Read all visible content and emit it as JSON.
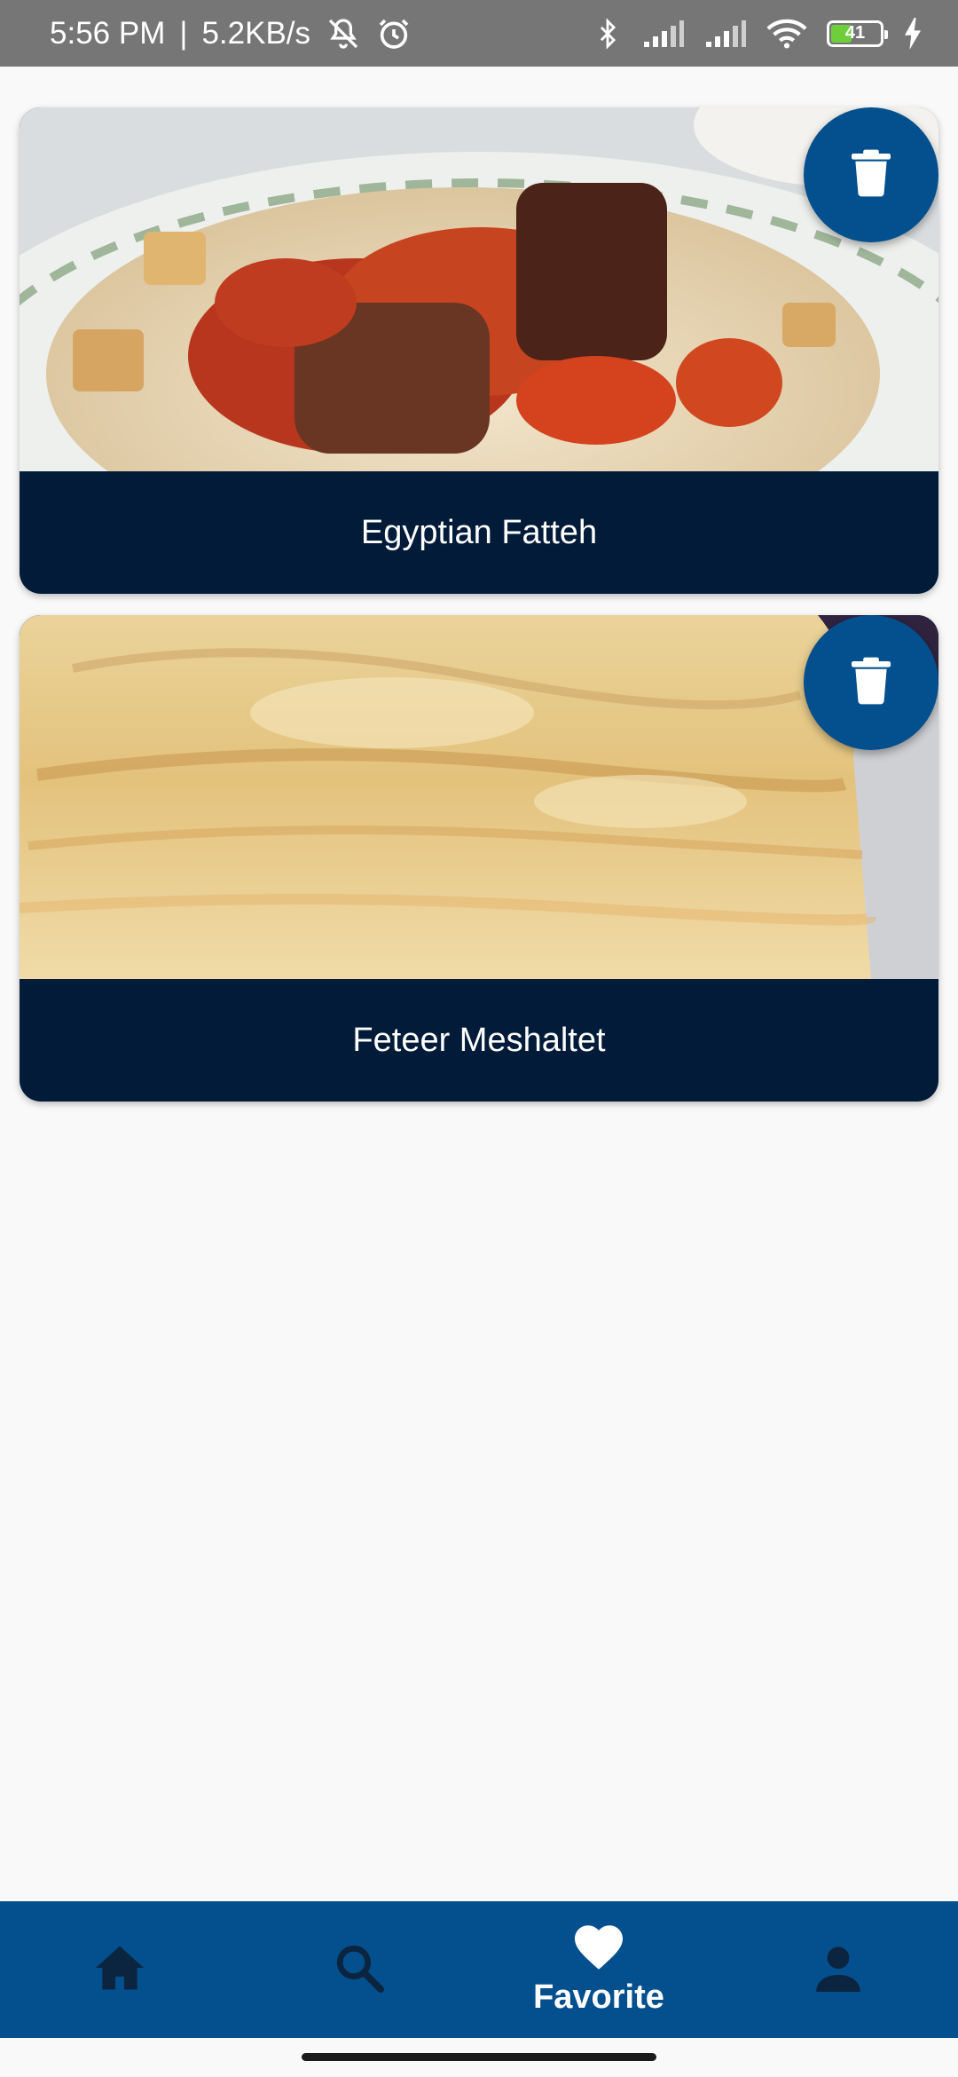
{
  "status_bar": {
    "time": "5:56 PM",
    "separator": "|",
    "network_speed": "5.2KB/s",
    "battery_level": "41"
  },
  "favorites": [
    {
      "title": "Egyptian Fatteh",
      "delete_icon": "trash-icon"
    },
    {
      "title": "Feteer Meshaltet",
      "delete_icon": "trash-icon"
    }
  ],
  "bottom_nav": {
    "items": [
      {
        "icon": "home-icon",
        "label": ""
      },
      {
        "icon": "search-icon",
        "label": ""
      },
      {
        "icon": "heart-icon",
        "label": "Favorite",
        "active": true
      },
      {
        "icon": "person-icon",
        "label": ""
      }
    ]
  },
  "colors": {
    "nav_background": "#04508e",
    "caption_background": "#011b38",
    "fab_background": "#04508e",
    "inactive_icon": "#0b2540",
    "active_icon": "#ffffff"
  }
}
